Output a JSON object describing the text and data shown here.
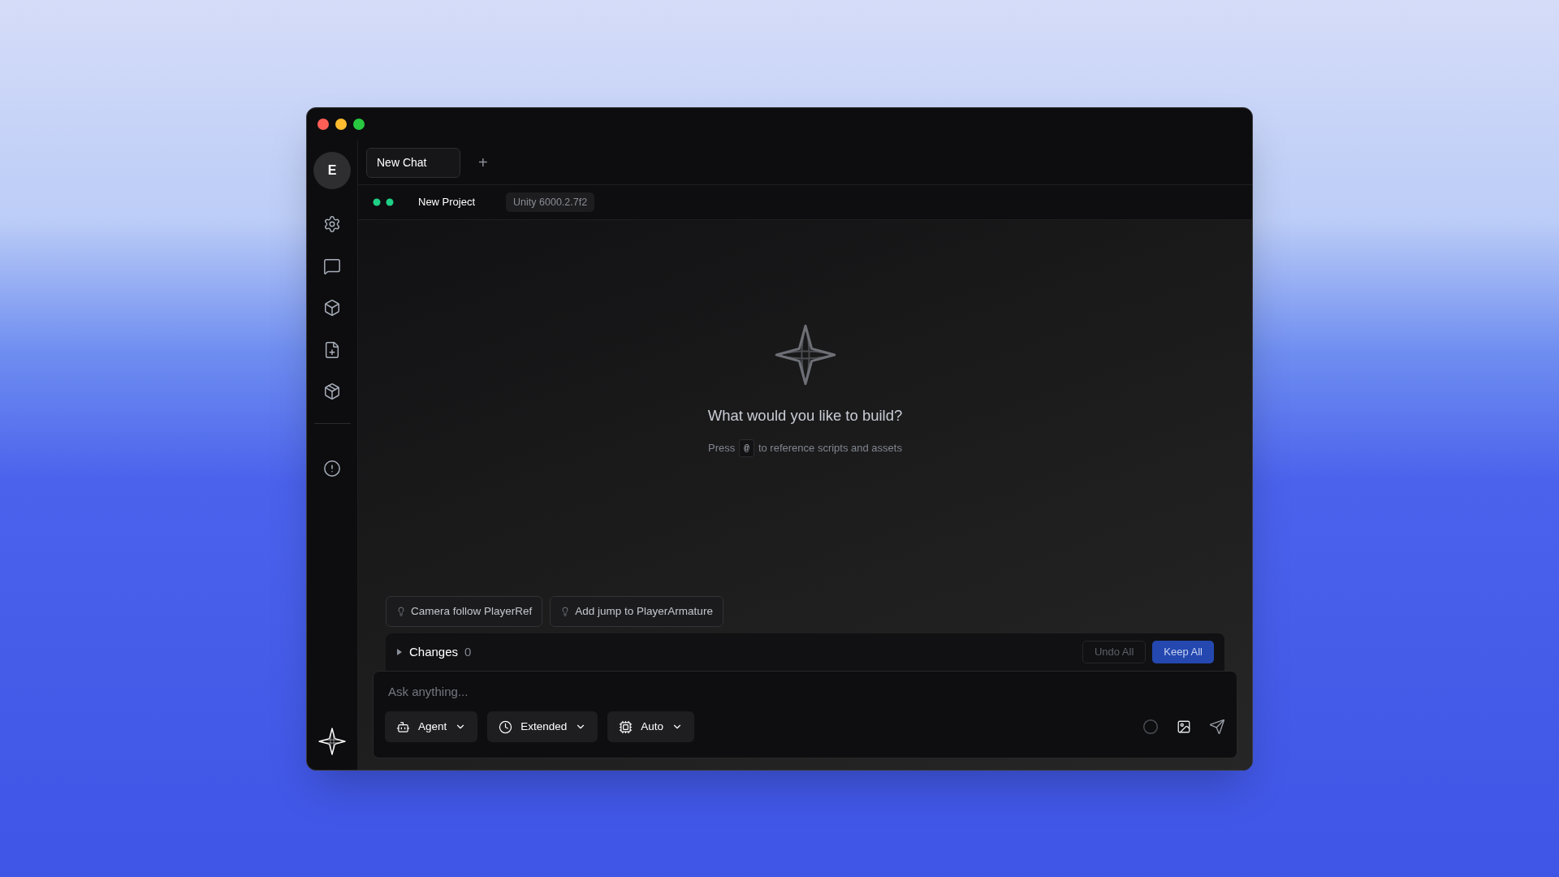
{
  "sidebar": {
    "avatar": "E"
  },
  "tabs": [
    {
      "label": "New Chat",
      "selected": true
    }
  ],
  "add_tab": "+",
  "project": {
    "name": "New Project",
    "version": "Unity 6000.2.7f2"
  },
  "empty_state": {
    "title": "What would you like to build?",
    "hint_before": "Press",
    "key": "@",
    "hint_after": "to reference scripts and assets"
  },
  "suggestions": [
    "Camera follow PlayerRef",
    "Add jump to PlayerArmature"
  ],
  "changes": {
    "label": "Changes",
    "count": "0",
    "expanded": false,
    "buttons": [
      {
        "label": "Undo All",
        "kind": "secondary"
      },
      {
        "label": "Keep All",
        "kind": "primary"
      }
    ]
  },
  "composer": {
    "placeholder": "Ask anything...",
    "modes": [
      {
        "label": "Agent",
        "kind": "agent"
      },
      {
        "label": "Extended",
        "kind": "clock"
      },
      {
        "label": "Auto",
        "kind": "chip"
      }
    ]
  }
}
